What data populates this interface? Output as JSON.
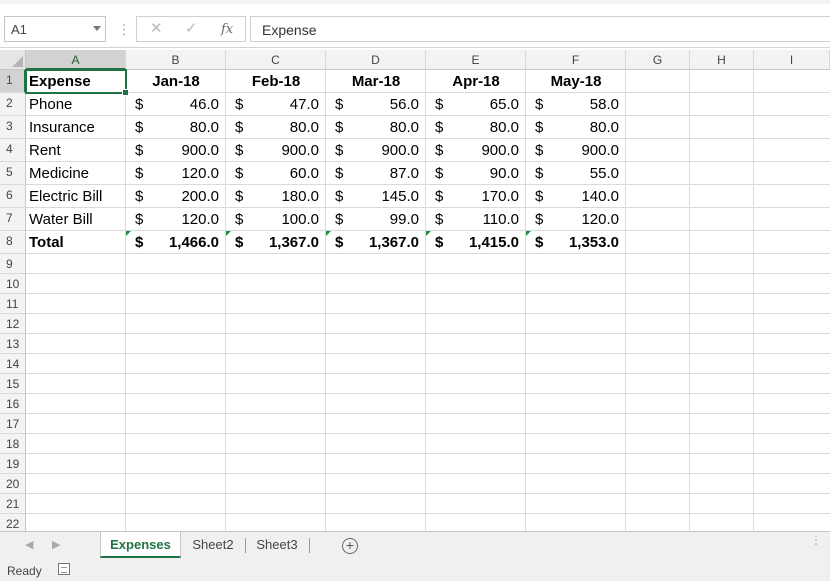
{
  "formula_bar": {
    "name_box": "A1",
    "separator_glyph": "⋮",
    "cancel_glyph": "✕",
    "enter_glyph": "✓",
    "fx_glyph": "fx",
    "content": "Expense"
  },
  "columns": [
    "A",
    "B",
    "C",
    "D",
    "E",
    "F",
    "G",
    "H",
    "I"
  ],
  "rows": [
    "1",
    "2",
    "3",
    "4",
    "5",
    "6",
    "7",
    "8",
    "9",
    "10",
    "11",
    "12",
    "13",
    "14",
    "15",
    "16",
    "17",
    "18",
    "19",
    "20",
    "21",
    "22"
  ],
  "sheet": {
    "header": {
      "label": "Expense",
      "months": [
        "Jan-18",
        "Feb-18",
        "Mar-18",
        "Apr-18",
        "May-18"
      ]
    },
    "currency_symbol": "$",
    "expenses": [
      {
        "label": "Phone",
        "values": [
          "46.0",
          "47.0",
          "56.0",
          "65.0",
          "58.0"
        ]
      },
      {
        "label": "Insurance",
        "values": [
          "80.0",
          "80.0",
          "80.0",
          "80.0",
          "80.0"
        ]
      },
      {
        "label": "Rent",
        "values": [
          "900.0",
          "900.0",
          "900.0",
          "900.0",
          "900.0"
        ]
      },
      {
        "label": "Medicine",
        "values": [
          "120.0",
          "60.0",
          "87.0",
          "90.0",
          "55.0"
        ]
      },
      {
        "label": "Electric Bill",
        "values": [
          "200.0",
          "180.0",
          "145.0",
          "170.0",
          "140.0"
        ]
      },
      {
        "label": "Water Bill",
        "values": [
          "120.0",
          "100.0",
          "99.0",
          "110.0",
          "120.0"
        ]
      }
    ],
    "total": {
      "label": "Total",
      "values": [
        "1,466.0",
        "1,367.0",
        "1,367.0",
        "1,415.0",
        "1,353.0"
      ]
    }
  },
  "tabs": {
    "nav_prev": "◀",
    "nav_next": "▶",
    "sheets": [
      "Expenses",
      "Sheet2",
      "Sheet3"
    ],
    "add_glyph": "+",
    "more_glyph": "⋮"
  },
  "status": {
    "text": "Ready"
  },
  "colors": {
    "accent": "#217346",
    "error_triangle": "#1d8f3f"
  }
}
